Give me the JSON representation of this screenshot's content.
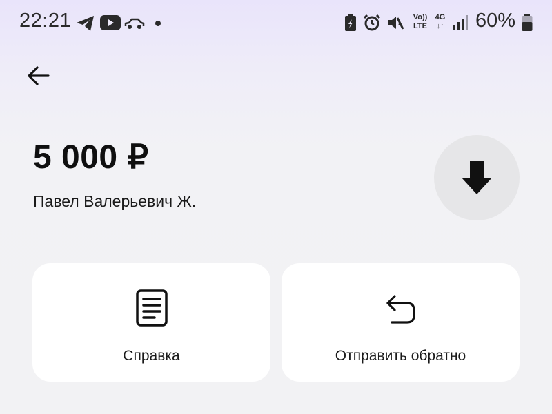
{
  "status_bar": {
    "time": "22:21",
    "battery_percent": "60%",
    "network_4g": "4G",
    "network_lte": "LTE",
    "volte": "Vo))",
    "icons": [
      "telegram-icon",
      "youtube-icon",
      "car-icon",
      "dot-icon",
      "battery-saver-icon",
      "alarm-icon",
      "vibrate-icon",
      "volte-icon",
      "4g-icon",
      "signal-icon",
      "battery-icon"
    ]
  },
  "header": {
    "back_icon": "arrow-left-icon"
  },
  "transfer": {
    "amount": "5 000 ₽",
    "recipient": "Павел Валерьевич Ж.",
    "direction_icon": "arrow-down-icon"
  },
  "actions": [
    {
      "label": "Справка",
      "icon": "document-icon"
    },
    {
      "label": "Отправить обратно",
      "icon": "return-icon"
    }
  ],
  "colors": {
    "accent_bg": "#e9e4fb",
    "card_bg": "#ffffff",
    "circle_bg": "#e6e6e8"
  }
}
